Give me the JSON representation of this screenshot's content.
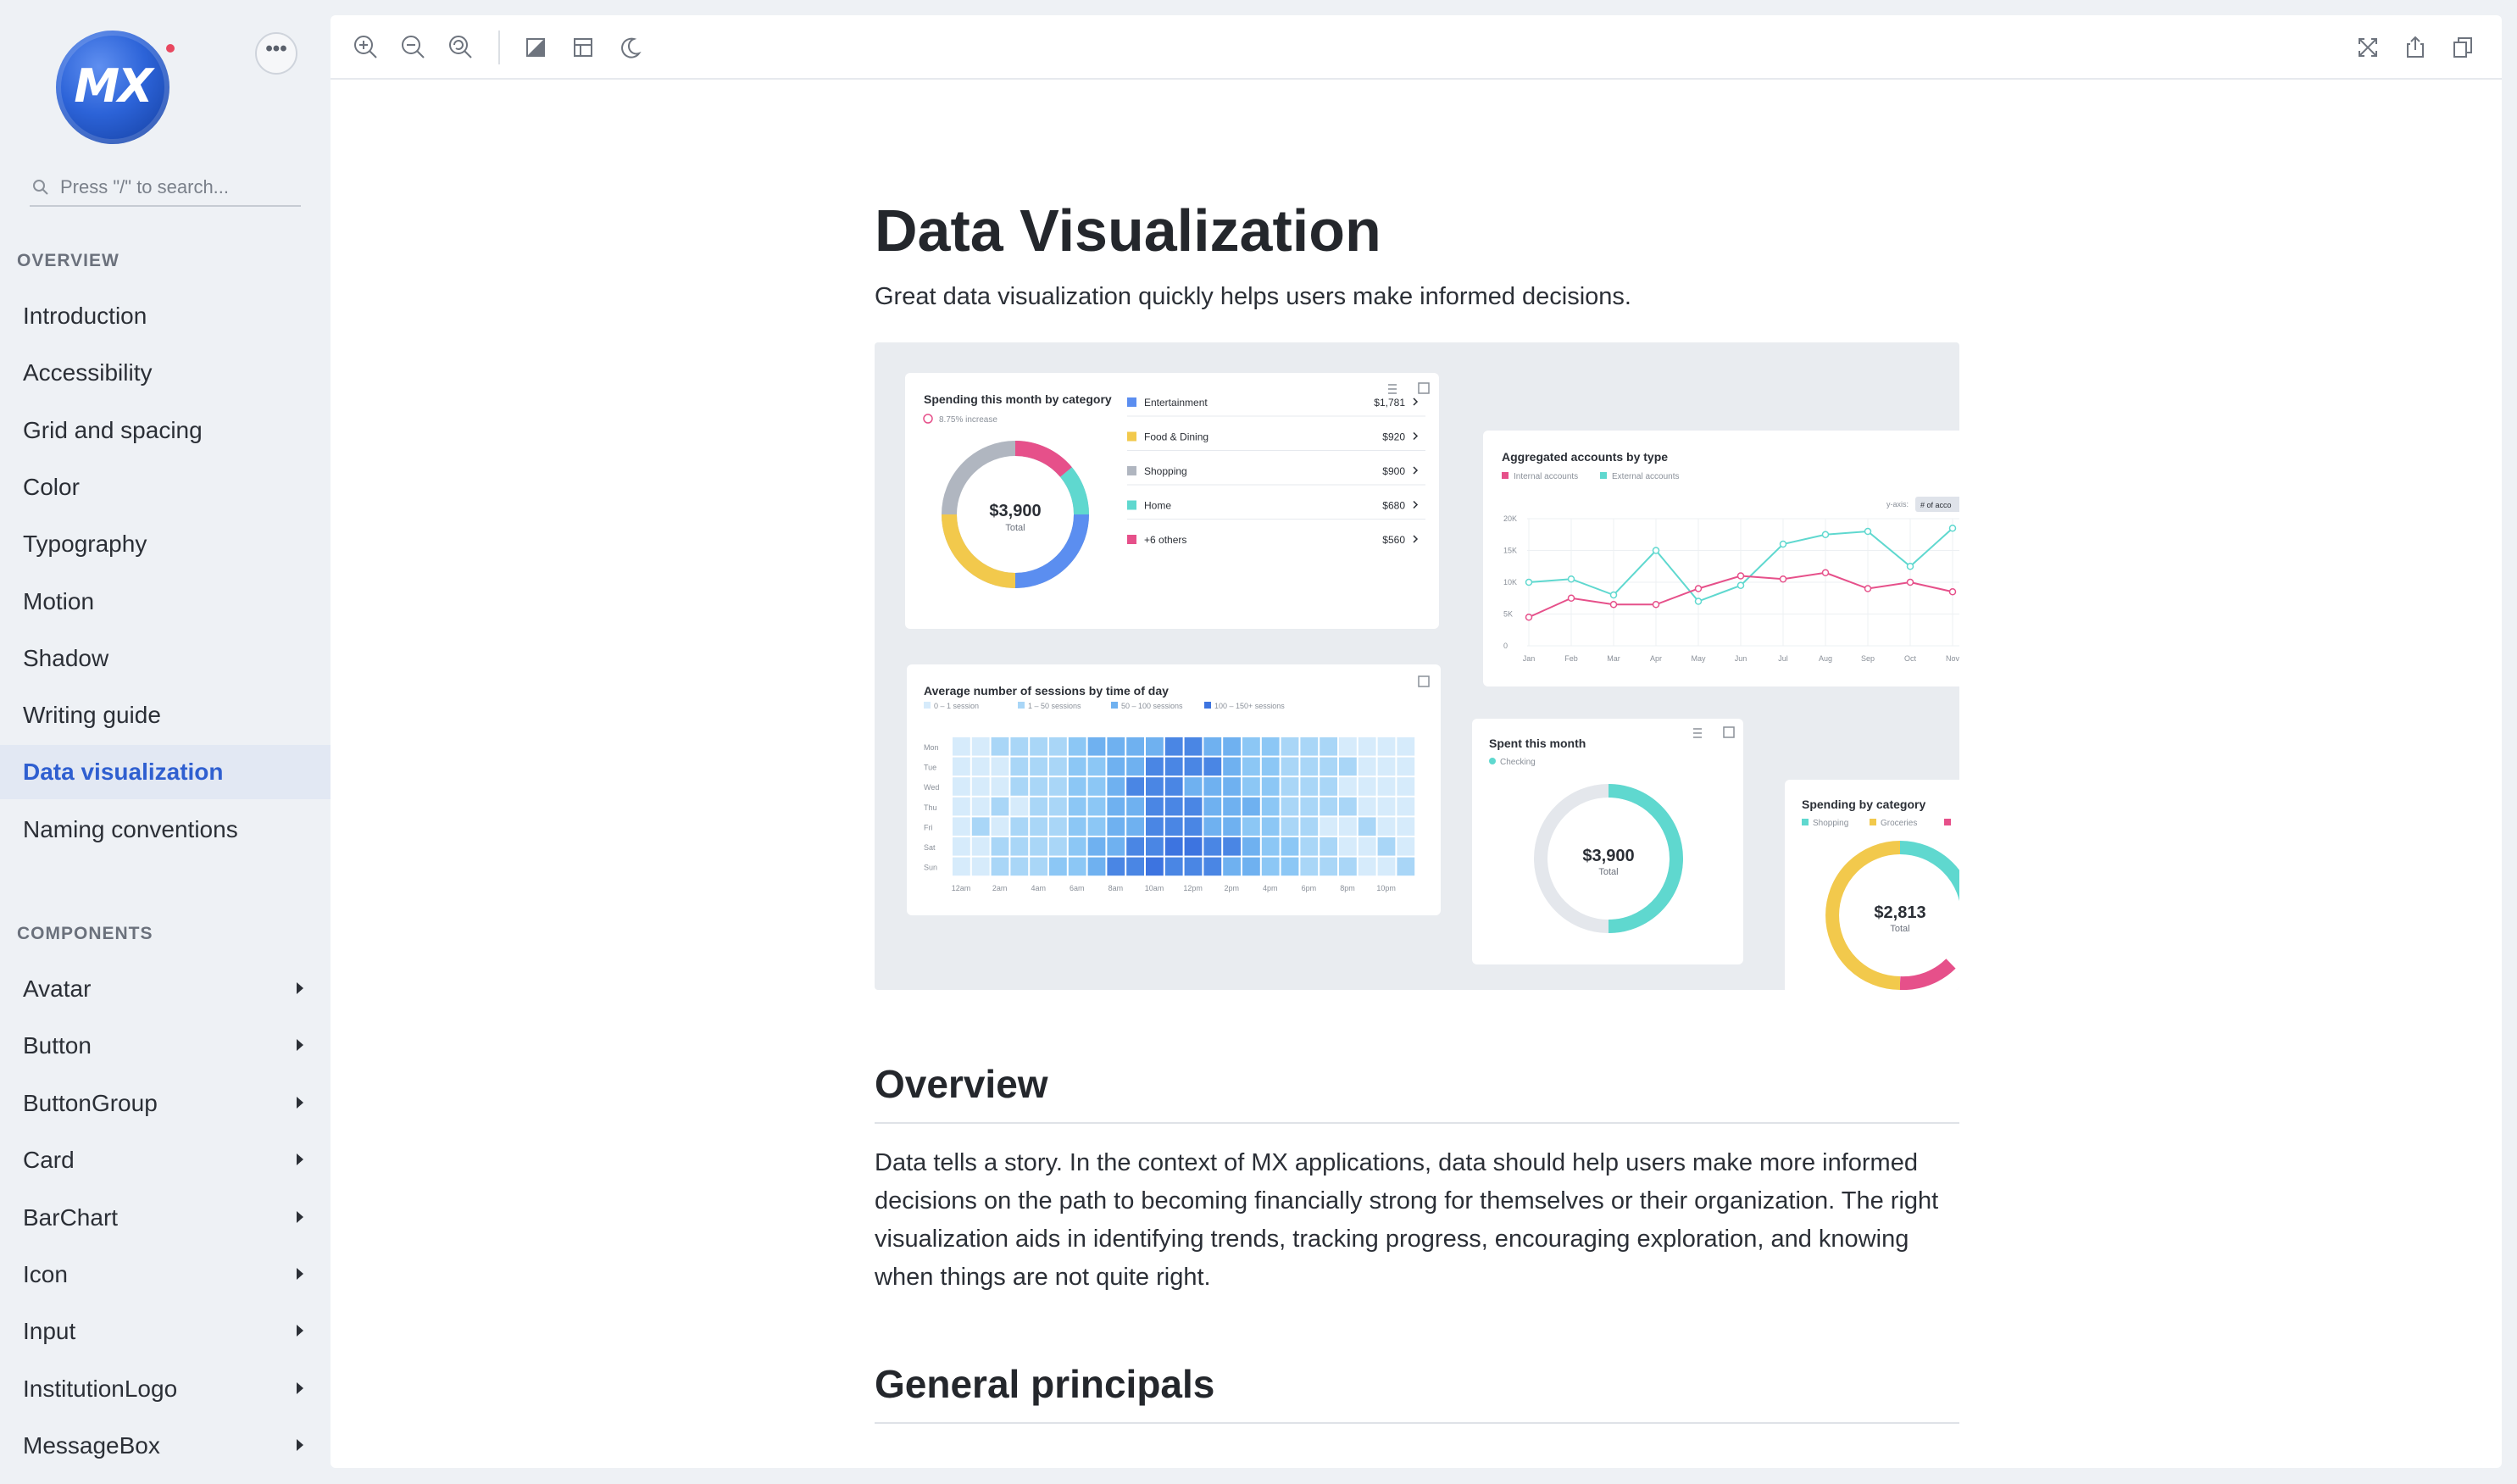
{
  "sidebar": {
    "logo_text": "MX",
    "more_label": "•••",
    "search_placeholder": "Press \"/\" to search...",
    "overview_title": "OVERVIEW",
    "overview_items": [
      "Introduction",
      "Accessibility",
      "Grid and spacing",
      "Color",
      "Typography",
      "Motion",
      "Shadow",
      "Writing guide",
      "Data visualization",
      "Naming conventions"
    ],
    "active_item": "Data visualization",
    "components_title": "COMPONENTS",
    "component_items": [
      "Avatar",
      "Button",
      "ButtonGroup",
      "Card",
      "BarChart",
      "Icon",
      "Input",
      "InstitutionLogo",
      "MessageBox"
    ]
  },
  "toolbar": {
    "left_icons": [
      "zoom-in-icon",
      "zoom-out-icon",
      "reset-zoom-icon",
      "background-icon",
      "grid-icon",
      "dark-mode-icon"
    ],
    "right_icons": [
      "fullscreen-icon",
      "share-icon",
      "copy-icon"
    ]
  },
  "content": {
    "title": "Data Visualization",
    "subtitle": "Great data visualization quickly helps users make informed decisions.",
    "overview_heading": "Overview",
    "overview_text": "Data tells a story. In the context of MX applications, data should help users make more informed decisions on the path to becoming financially strong for themselves or their organization. The right visualization aids in identifying trends, tracking progress, encouraging exploration, and knowing when things are not quite right.",
    "principles_heading": "General principals"
  },
  "hero": {
    "spending_card": {
      "title": "Spending this month by category",
      "increase": "8.75% increase",
      "total_value": "$3,900",
      "total_label": "Total",
      "rows": [
        {
          "label": "Entertainment",
          "value": "$1,781",
          "color": "#5b8ef0"
        },
        {
          "label": "Food & Dining",
          "value": "$920",
          "color": "#f2c94c"
        },
        {
          "label": "Shopping",
          "value": "$900",
          "color": "#b0b6c0"
        },
        {
          "label": "Home",
          "value": "$680",
          "color": "#5fd8cf"
        },
        {
          "label": "+6 others",
          "value": "$560",
          "color": "#e6508a"
        }
      ]
    },
    "accounts_card": {
      "title": "Aggregated accounts by type",
      "legend": [
        {
          "label": "Internal accounts",
          "color": "#e6508a"
        },
        {
          "label": "External accounts",
          "color": "#5fd8cf"
        }
      ],
      "toggle_left": "y-axis:",
      "toggle_right": "# of acco",
      "y_ticks": [
        "20K",
        "15K",
        "10K",
        "5K",
        "0"
      ],
      "months": [
        "Jan",
        "Feb",
        "Mar",
        "Apr",
        "May",
        "Jun",
        "Jul",
        "Aug",
        "Sep",
        "Oct",
        "Nov"
      ]
    },
    "sessions_card": {
      "title": "Average number of sessions by time of day",
      "legend": [
        "0 – 1 session",
        "1 – 50 sessions",
        "50 – 100 sessions",
        "100 – 150+ sessions"
      ],
      "days": [
        "Mon",
        "Tue",
        "Wed",
        "Thu",
        "Fri",
        "Sat",
        "Sun"
      ],
      "hours": [
        "12am",
        "2am",
        "4am",
        "6am",
        "8am",
        "10am",
        "12pm",
        "2pm",
        "4pm",
        "6pm",
        "8pm",
        "10pm"
      ]
    },
    "spent_card": {
      "title": "Spent this month",
      "legend": "Checking",
      "value": "$3,900",
      "label": "Total"
    },
    "category_card": {
      "title": "Spending by category",
      "legend": [
        "Shopping",
        "Groceries"
      ],
      "value": "$2,813",
      "label": "Total"
    }
  }
}
